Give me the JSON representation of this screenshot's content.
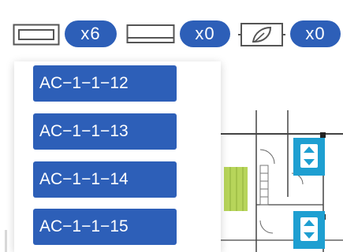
{
  "toolbar": {
    "counters": [
      {
        "icon": "panel-light-icon",
        "count": "x6"
      },
      {
        "icon": "linear-light-icon",
        "count": "x0"
      },
      {
        "icon": "plant-light-icon",
        "count": "x0"
      }
    ]
  },
  "dropdown": {
    "items": [
      "AC−1−1−12",
      "AC−1−1−13",
      "AC−1−1−14",
      "AC−1−1−15"
    ]
  },
  "colors": {
    "accent": "#2d5fb8",
    "device_cyan": "#1e9fd1",
    "lift_green": "#b7d55a"
  }
}
